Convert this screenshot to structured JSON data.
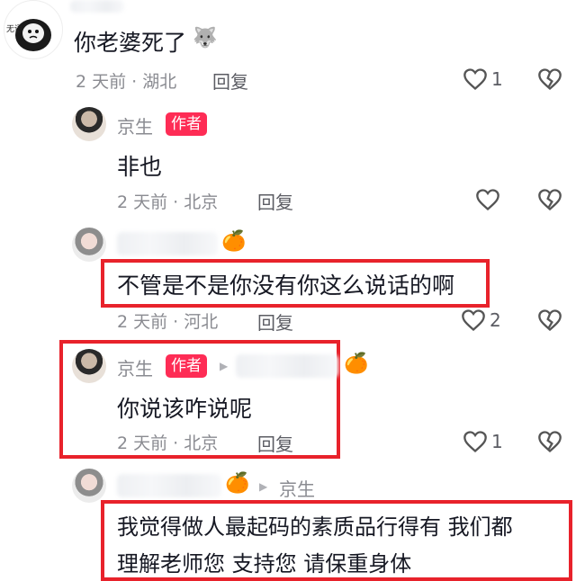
{
  "comment1": {
    "content": "你老婆死了",
    "time_location": "2 天前 · 湖北",
    "reply": "回复",
    "likes": "1",
    "avatar_text": "无语"
  },
  "reply1": {
    "name": "京生",
    "badge": "作者",
    "content": "非也",
    "time_location": "2 天前 · 北京",
    "reply": "回复"
  },
  "reply2": {
    "content": "不管是不是你没有你这么说话的啊",
    "time_location": "2 天前 · 河北",
    "reply": "回复",
    "likes": "2"
  },
  "reply3": {
    "name": "京生",
    "badge": "作者",
    "content": "你说该咋说呢",
    "time_location": "2 天前 · 北京",
    "reply": "回复",
    "likes": "1"
  },
  "reply4": {
    "reply_to": "京生",
    "content_line1": "我觉得做人最起码的素质品行得有 我们都",
    "content_line2": "理解老师您 支持您 请保重身体"
  },
  "colors": {
    "accent": "#fe2c55",
    "highlight_box": "#e8222b"
  }
}
